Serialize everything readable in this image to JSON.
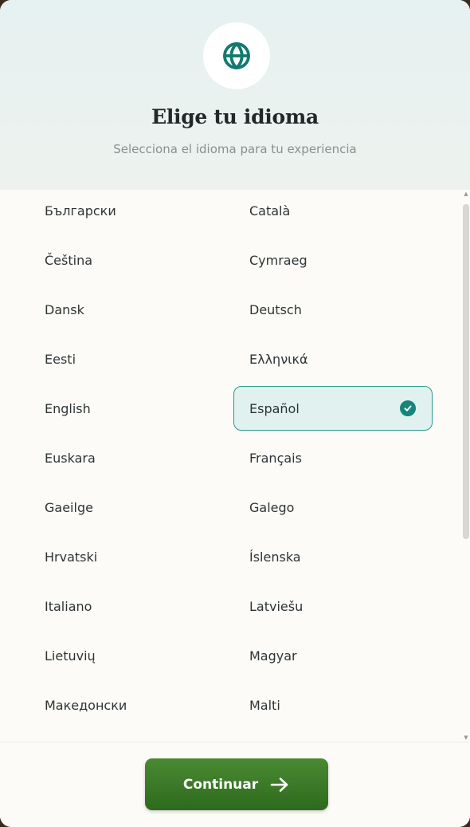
{
  "header": {
    "icon": "globe-icon",
    "title": "Elige tu idioma",
    "subtitle": "Selecciona el idioma para tu experiencia"
  },
  "languages": {
    "left": [
      "Български",
      "Čeština",
      "Dansk",
      "Eesti",
      "English",
      "Euskara",
      "Gaeilge",
      "Hrvatski",
      "Italiano",
      "Lietuvių",
      "Македонски"
    ],
    "right": [
      "Català",
      "Cymraeg",
      "Deutsch",
      "Ελληνικά",
      "Español",
      "Français",
      "Galego",
      "Íslenska",
      "Latviešu",
      "Magyar",
      "Malti"
    ],
    "selected": "Español"
  },
  "footer": {
    "continue_label": "Continuar",
    "continue_icon": "arrow-right-icon"
  },
  "colors": {
    "accent": "#16857a",
    "button": "#3d7b2a"
  }
}
